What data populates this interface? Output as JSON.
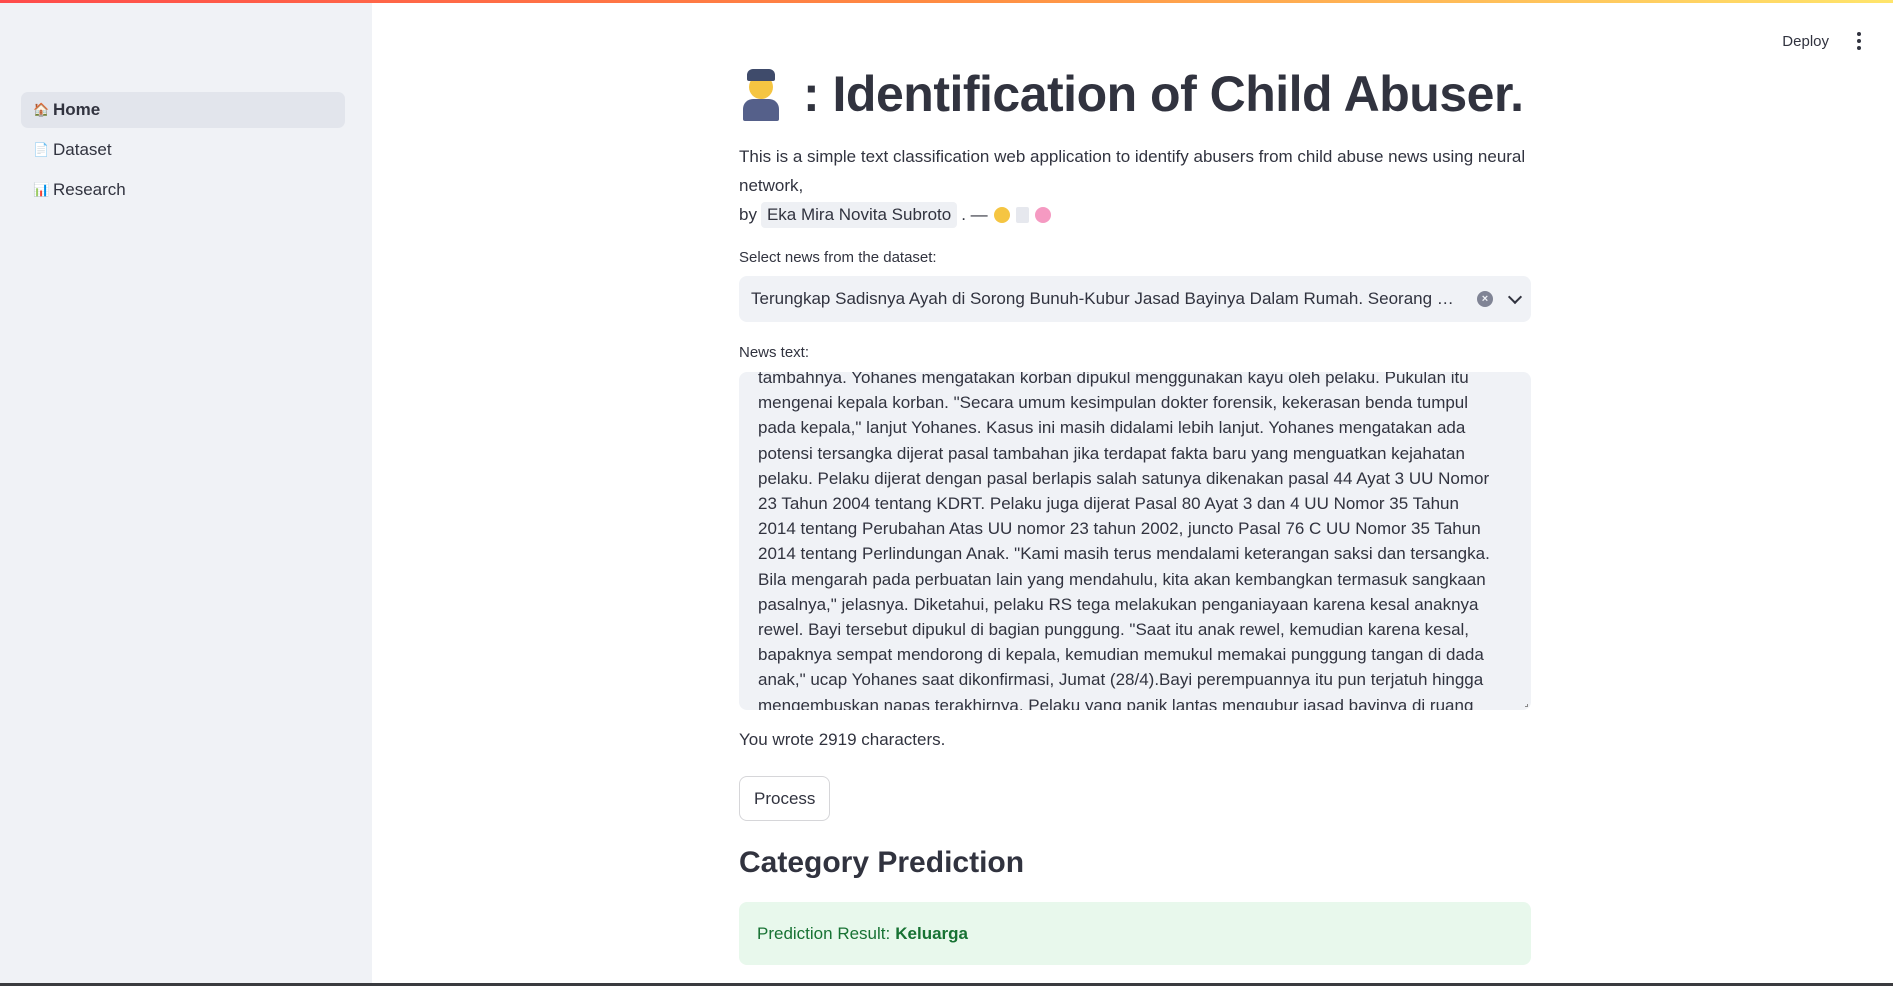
{
  "header": {
    "deploy_label": "Deploy"
  },
  "sidebar": {
    "items": [
      {
        "label": "Home",
        "icon": "house-icon",
        "active": true
      },
      {
        "label": "Dataset",
        "icon": "document-icon",
        "active": false
      },
      {
        "label": "Research",
        "icon": "bar-chart-icon",
        "active": false
      }
    ]
  },
  "main": {
    "title": ": Identification of Child Abuser.",
    "title_icon": "police-officer-icon",
    "description": "This is a simple text classification web application to identify abusers from child abuse news using neural network,",
    "by_label": "by",
    "author": "Eka Mira Novita Subroto",
    "author_suffix": ". —",
    "select_label": "Select news from the dataset:",
    "selected_news": "Terungkap Sadisnya Ayah di Sorong Bunuh-Kubur Jasad Bayinya Dalam Rumah. Seorang ay…",
    "news_text_label": "News text:",
    "news_text": "tambahnya. Yohanes mengatakan korban dipukul menggunakan kayu oleh pelaku. Pukulan itu mengenai kepala korban. \"Secara umum kesimpulan dokter forensik, kekerasan benda tumpul pada kepala,\" lanjut Yohanes. Kasus ini masih didalami lebih lanjut. Yohanes mengatakan ada potensi tersangka dijerat pasal tambahan jika terdapat fakta baru yang menguatkan kejahatan pelaku. Pelaku dijerat dengan pasal berlapis salah satunya dikenakan pasal 44 Ayat 3 UU Nomor 23 Tahun 2004 tentang KDRT. Pelaku juga dijerat Pasal 80 Ayat 3 dan 4 UU Nomor 35 Tahun 2014 tentang Perubahan Atas UU nomor 23 tahun 2002, juncto Pasal 76 C UU Nomor 35 Tahun 2014 tentang Perlindungan Anak. \"Kami masih terus mendalami keterangan saksi dan tersangka. Bila mengarah pada perbuatan lain yang mendahulu, kita akan kembangkan termasuk sangkaan pasalnya,\" jelasnya. Diketahui, pelaku RS tega melakukan penganiayaan karena kesal anaknya rewel. Bayi tersebut dipukul di bagian punggung. \"Saat itu anak rewel, kemudian karena kesal, bapaknya sempat mendorong di kepala, kemudian memukul memakai punggung tangan di dada anak,\" ucap Yohanes saat dikonfirmasi, Jumat (28/4).Bayi perempuannya itu pun terjatuh hingga mengembuskan napas terakhirnya. Pelaku yang panik lantas mengubur jasad bayinya di ruang",
    "char_count_text": "You wrote 2919 characters.",
    "process_label": "Process",
    "prediction_heading": "Category Prediction",
    "prediction_prefix": "Prediction Result:",
    "prediction_value": "Keluarga"
  },
  "colors": {
    "sidebar_bg": "#f0f2f6",
    "success_bg": "#e8f8ec",
    "success_text": "#177233",
    "accent": "#ff4b4b"
  }
}
